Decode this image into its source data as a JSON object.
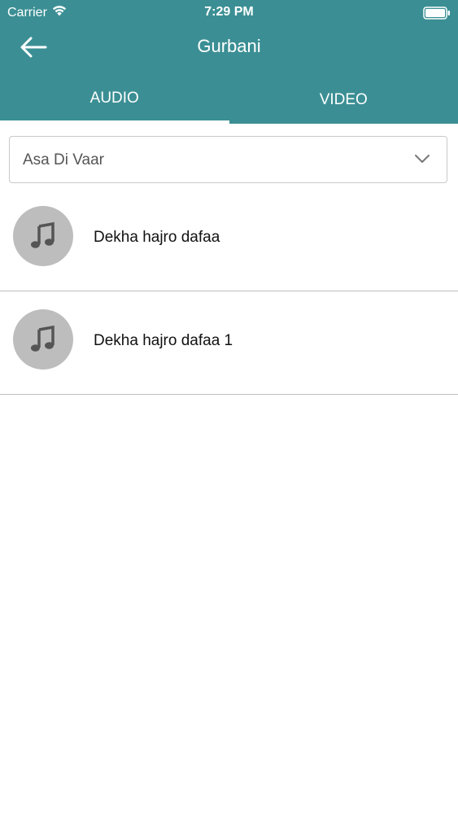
{
  "status_bar": {
    "carrier": "Carrier",
    "time": "7:29 PM"
  },
  "nav": {
    "title": "Gurbani"
  },
  "tabs": [
    {
      "label": "AUDIO",
      "active": true
    },
    {
      "label": "VIDEO",
      "active": false
    }
  ],
  "dropdown": {
    "selected": "Asa Di Vaar"
  },
  "tracks": [
    {
      "title": "Dekha hajro dafaa",
      "icon": "music-note-icon"
    },
    {
      "title": "Dekha hajro dafaa 1",
      "icon": "music-note-icon"
    }
  ],
  "colors": {
    "header_bg": "#3b8f94",
    "icon_circle": "#bdbdbd",
    "divider": "#bdbdbd"
  }
}
